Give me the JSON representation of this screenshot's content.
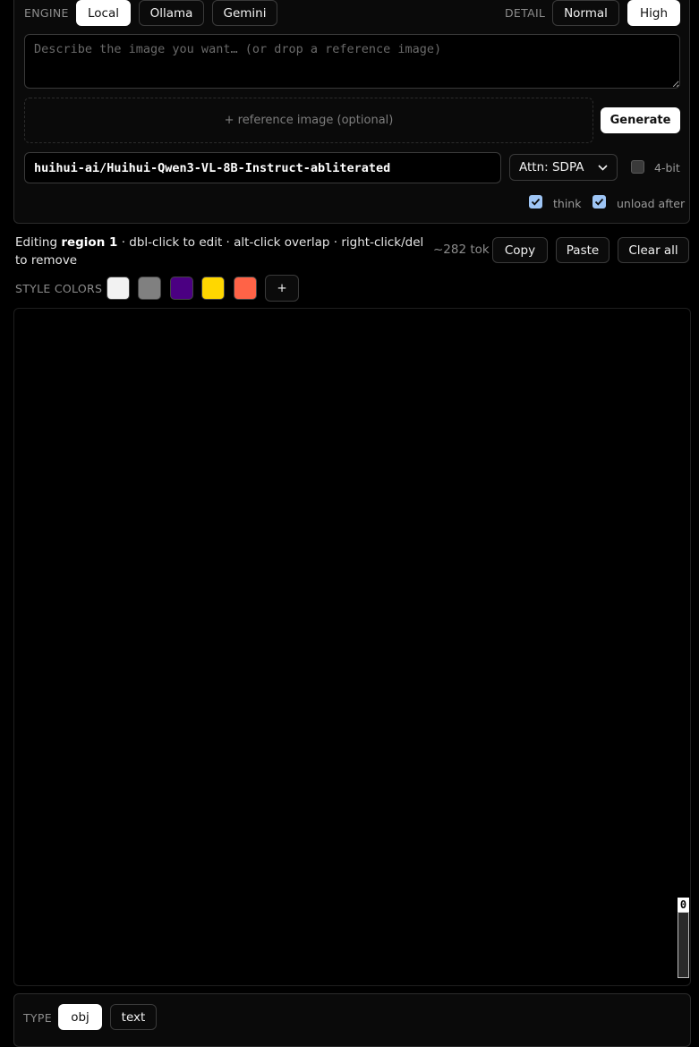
{
  "engine": {
    "label": "ENGINE",
    "options": [
      "Local",
      "Ollama",
      "Gemini"
    ],
    "selected": "Local"
  },
  "detail": {
    "label": "DETAIL",
    "options": [
      "Normal",
      "High"
    ],
    "selected": "High"
  },
  "prompt": {
    "value": "",
    "placeholder": "Describe the image you want… (or drop a reference image)"
  },
  "reference": {
    "label": "+ reference image (optional)"
  },
  "generate_label": "Generate",
  "model": {
    "value": "huihui-ai/Huihui-Qwen3-VL-8B-Instruct-abliterated"
  },
  "attn": {
    "selected": "Attn: SDPA"
  },
  "options": {
    "four_bit": {
      "label": "4-bit",
      "checked": false
    },
    "think": {
      "label": "think",
      "checked": true
    },
    "unload_after": {
      "label": "unload after",
      "checked": true
    }
  },
  "editing": {
    "prefix": "Editing ",
    "region": "region 1",
    "hint": " · dbl-click to edit · alt-click overlap · right-click/del to remove"
  },
  "token_count": "~282 tok",
  "actions": {
    "copy": "Copy",
    "paste": "Paste",
    "clear_all": "Clear all"
  },
  "style_colors": {
    "label": "STYLE COLORS",
    "swatches": [
      "#f2f2f2",
      "#808080",
      "#4b0082",
      "#ffd700",
      "#ff6347"
    ],
    "add_label": "+"
  },
  "canvas": {
    "scale_value": "0"
  },
  "type": {
    "label": "TYPE",
    "options": [
      "obj",
      "text"
    ],
    "selected": "obj"
  }
}
